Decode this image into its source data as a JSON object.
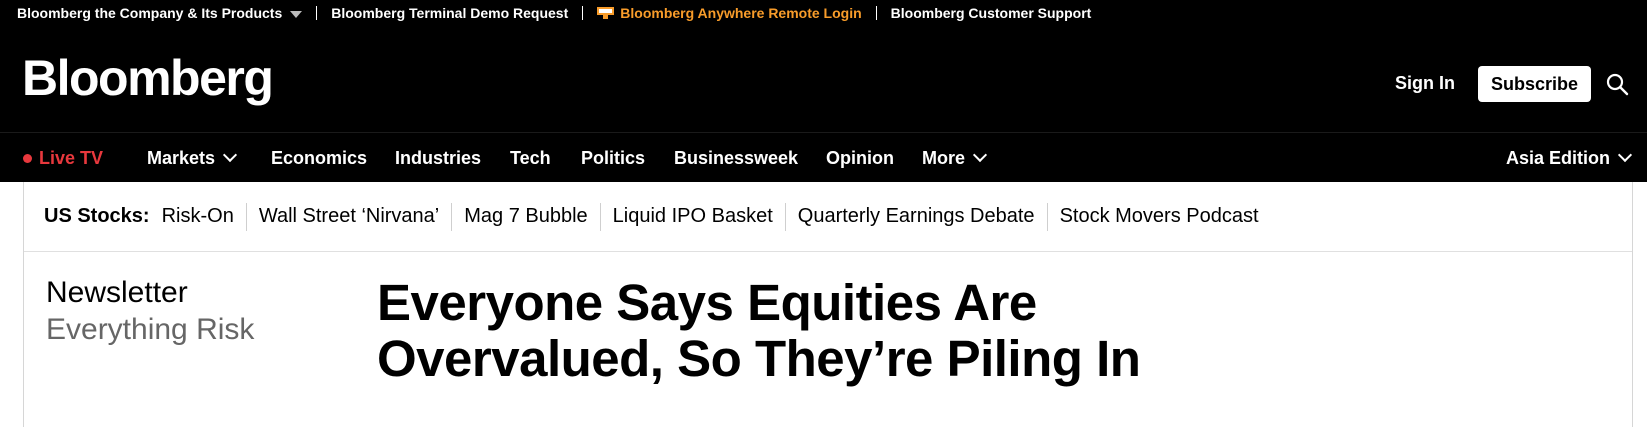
{
  "utility_bar": {
    "company_products": "Bloomberg the Company & Its Products",
    "terminal_demo": "Bloomberg Terminal Demo Request",
    "anywhere_login": "Bloomberg Anywhere Remote Login",
    "customer_support": "Bloomberg Customer Support",
    "accent_color": "#f89c2a"
  },
  "header": {
    "logo": "Bloomberg",
    "sign_in": "Sign In",
    "subscribe": "Subscribe",
    "search_icon": "search-icon"
  },
  "nav": {
    "live_tv": "Live TV",
    "live_color": "#e8383d",
    "items": [
      "Markets",
      "Economics",
      "Industries",
      "Tech",
      "Politics",
      "Businessweek",
      "Opinion",
      "More"
    ],
    "edition": "Asia Edition"
  },
  "topic_bar": {
    "label": "US Stocks:",
    "links": [
      "Risk-On",
      "Wall Street ‘Nirvana’",
      "Mag 7 Bubble",
      "Liquid IPO Basket",
      "Quarterly Earnings Debate",
      "Stock Movers Podcast"
    ]
  },
  "article": {
    "kicker": "Newsletter",
    "kicker_sub": "Everything Risk",
    "headline": "Everyone Says Equities Are Overvalued, So They’re Piling In"
  }
}
